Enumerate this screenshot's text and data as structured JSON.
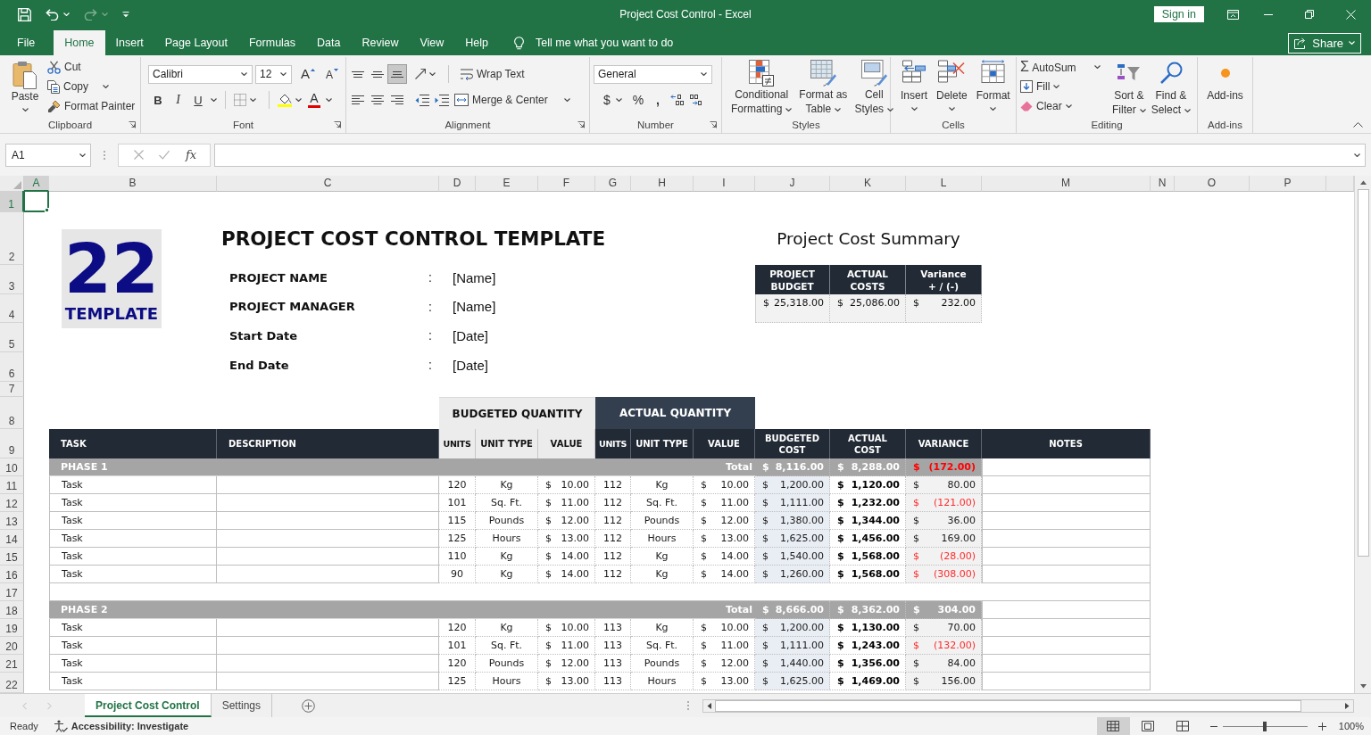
{
  "window": {
    "title": "Project Cost Control - Excel",
    "sign_in": "Sign in"
  },
  "quick_access": [
    {
      "kind": "save",
      "disabled": false
    },
    {
      "kind": "undo",
      "disabled": false
    },
    {
      "kind": "redo",
      "disabled": true
    },
    {
      "kind": "customize",
      "disabled": false
    }
  ],
  "menu": {
    "tabs": [
      {
        "label": "File",
        "selected": false
      },
      {
        "label": "Home",
        "selected": true
      },
      {
        "label": "Insert",
        "selected": false
      },
      {
        "label": "Page Layout",
        "selected": false
      },
      {
        "label": "Formulas",
        "selected": false
      },
      {
        "label": "Data",
        "selected": false
      },
      {
        "label": "Review",
        "selected": false
      },
      {
        "label": "View",
        "selected": false
      },
      {
        "label": "Help",
        "selected": false
      }
    ],
    "tell_me": "Tell me what you want to do",
    "share": "Share"
  },
  "ribbon": [
    {
      "kind": "clipboard",
      "label": "Clipboard",
      "launcher": true,
      "paste": "Paste",
      "cut": "Cut",
      "copy": "Copy",
      "format_painter": "Format Painter"
    },
    {
      "kind": "font",
      "label": "Font",
      "launcher": true,
      "font_name": "Calibri",
      "font_size": "12",
      "grow": "A",
      "shrink": "A",
      "bold": "B",
      "italic": "I",
      "underline": "U",
      "font_color": "A"
    },
    {
      "kind": "alignment",
      "label": "Alignment",
      "launcher": true,
      "vertical_align": [
        {
          "kind": "top",
          "selected": false
        },
        {
          "kind": "middle",
          "selected": false
        },
        {
          "kind": "bottom",
          "selected": true
        }
      ],
      "wrap_text": "Wrap Text",
      "merge": "Merge & Center"
    },
    {
      "kind": "number",
      "label": "Number",
      "launcher": true,
      "format": "General",
      "currency": "$",
      "percent": "%",
      "comma": ","
    },
    {
      "kind": "styles",
      "label": "Styles",
      "launcher": false,
      "buttons": [
        {
          "kind": "conditional",
          "label": "Conditional\nFormatting"
        },
        {
          "kind": "table",
          "label": "Format as\nTable"
        },
        {
          "kind": "cell",
          "label": "Cell\nStyles"
        }
      ]
    },
    {
      "kind": "cells",
      "label": "Cells",
      "launcher": false,
      "buttons": [
        {
          "kind": "insert",
          "label": "Insert"
        },
        {
          "kind": "delete",
          "label": "Delete"
        },
        {
          "kind": "format",
          "label": "Format"
        }
      ]
    },
    {
      "kind": "editing",
      "label": "Editing",
      "launcher": false,
      "sum_symbol": "Σ",
      "autosum": "AutoSum",
      "fill": "Fill",
      "clear": "Clear",
      "sort": "Sort &\nFilter",
      "find": "Find &\nSelect"
    },
    {
      "kind": "addins",
      "label": "Add-ins",
      "launcher": false,
      "button": "Add-ins"
    }
  ],
  "formula_bar": {
    "name_box": "A1",
    "function": "fx"
  },
  "sheet": {
    "columns": [
      {
        "label": "A",
        "selected": true
      },
      {
        "label": "B",
        "selected": false
      },
      {
        "label": "C",
        "selected": false
      },
      {
        "label": "D",
        "selected": false
      },
      {
        "label": "E",
        "selected": false
      },
      {
        "label": "F",
        "selected": false
      },
      {
        "label": "G",
        "selected": false
      },
      {
        "label": "H",
        "selected": false
      },
      {
        "label": "I",
        "selected": false
      },
      {
        "label": "J",
        "selected": false
      },
      {
        "label": "K",
        "selected": false
      },
      {
        "label": "L",
        "selected": false
      },
      {
        "label": "M",
        "selected": false
      },
      {
        "label": "N",
        "selected": false
      },
      {
        "label": "O",
        "selected": false
      },
      {
        "label": "P",
        "selected": false
      }
    ],
    "rows": [
      {
        "label": "1",
        "selected": true
      },
      {
        "label": "2",
        "selected": false
      },
      {
        "label": "3",
        "selected": false
      },
      {
        "label": "4",
        "selected": false
      },
      {
        "label": "5",
        "selected": false
      },
      {
        "label": "6",
        "selected": false
      },
      {
        "label": "7",
        "selected": false
      },
      {
        "label": "8",
        "selected": false
      },
      {
        "label": "9",
        "selected": false
      },
      {
        "label": "10",
        "selected": false
      },
      {
        "label": "11",
        "selected": false
      },
      {
        "label": "12",
        "selected": false
      },
      {
        "label": "13",
        "selected": false
      },
      {
        "label": "14",
        "selected": false
      },
      {
        "label": "15",
        "selected": false
      },
      {
        "label": "16",
        "selected": false
      },
      {
        "label": "17",
        "selected": false
      },
      {
        "label": "18",
        "selected": false
      },
      {
        "label": "19",
        "selected": false
      },
      {
        "label": "20",
        "selected": false
      },
      {
        "label": "21",
        "selected": false
      },
      {
        "label": "22",
        "selected": false
      }
    ]
  },
  "logo": {
    "number": "22",
    "word": "TEMPLATE"
  },
  "title": "PROJECT COST CONTROL TEMPLATE",
  "details": [
    {
      "label": "PROJECT NAME",
      "separator": ":",
      "value": "[Name]"
    },
    {
      "label": "PROJECT MANAGER",
      "separator": ":",
      "value": "[Name]"
    },
    {
      "label": "Start Date",
      "separator": ":",
      "value": "[Date]"
    },
    {
      "label": "End Date",
      "separator": ":",
      "value": "[Date]"
    }
  ],
  "summary": {
    "title": "Project Cost Summary",
    "columns": [
      "PROJECT\nBUDGET",
      "ACTUAL\nCOSTS",
      "Variance\n+ / (-)"
    ],
    "values": [
      {
        "currency": "$",
        "amount": "25,318.00"
      },
      {
        "currency": "$",
        "amount": "25,086.00"
      },
      {
        "currency": "$",
        "amount": "232.00"
      }
    ]
  },
  "table": {
    "header": {
      "task": "TASK",
      "description": "DESCRIPTION",
      "budgeted_quantity": {
        "label": "BUDGETED QUANTITY",
        "units": "UNITS",
        "unit_type": "UNIT TYPE",
        "value": "VALUE"
      },
      "actual_quantity": {
        "label": "ACTUAL QUANTITY",
        "units": "UNITS",
        "unit_type": "UNIT TYPE",
        "value": "VALUE"
      },
      "budgeted_cost": "BUDGETED\nCOST",
      "actual_cost": "ACTUAL\nCOST",
      "variance": "VARIANCE",
      "notes": "NOTES"
    },
    "phases": [
      {
        "label": "PHASE 1",
        "total_label": "Total",
        "budgeted_cost": {
          "currency": "$",
          "amount": "8,116.00"
        },
        "actual_cost": {
          "currency": "$",
          "amount": "8,288.00"
        },
        "variance": {
          "currency": "$",
          "amount": "(172.00)",
          "negative": true
        },
        "tasks": [
          {
            "task": "Task",
            "budgeted": {
              "units": "120",
              "unit_type": "Kg",
              "value": {
                "currency": "$",
                "amount": "10.00"
              }
            },
            "actual": {
              "units": "112",
              "unit_type": "Kg",
              "value": {
                "currency": "$",
                "amount": "10.00"
              }
            },
            "budgeted_cost": {
              "currency": "$",
              "amount": "1,200.00"
            },
            "actual_cost": {
              "currency": "$",
              "amount": "1,120.00"
            },
            "variance": {
              "currency": "$",
              "amount": "80.00",
              "negative": false
            }
          },
          {
            "task": "Task",
            "budgeted": {
              "units": "101",
              "unit_type": "Sq. Ft.",
              "value": {
                "currency": "$",
                "amount": "11.00"
              }
            },
            "actual": {
              "units": "112",
              "unit_type": "Sq. Ft.",
              "value": {
                "currency": "$",
                "amount": "11.00"
              }
            },
            "budgeted_cost": {
              "currency": "$",
              "amount": "1,111.00"
            },
            "actual_cost": {
              "currency": "$",
              "amount": "1,232.00"
            },
            "variance": {
              "currency": "$",
              "amount": "(121.00)",
              "negative": true
            }
          },
          {
            "task": "Task",
            "budgeted": {
              "units": "115",
              "unit_type": "Pounds",
              "value": {
                "currency": "$",
                "amount": "12.00"
              }
            },
            "actual": {
              "units": "112",
              "unit_type": "Pounds",
              "value": {
                "currency": "$",
                "amount": "12.00"
              }
            },
            "budgeted_cost": {
              "currency": "$",
              "amount": "1,380.00"
            },
            "actual_cost": {
              "currency": "$",
              "amount": "1,344.00"
            },
            "variance": {
              "currency": "$",
              "amount": "36.00",
              "negative": false
            }
          },
          {
            "task": "Task",
            "budgeted": {
              "units": "125",
              "unit_type": "Hours",
              "value": {
                "currency": "$",
                "amount": "13.00"
              }
            },
            "actual": {
              "units": "112",
              "unit_type": "Hours",
              "value": {
                "currency": "$",
                "amount": "13.00"
              }
            },
            "budgeted_cost": {
              "currency": "$",
              "amount": "1,625.00"
            },
            "actual_cost": {
              "currency": "$",
              "amount": "1,456.00"
            },
            "variance": {
              "currency": "$",
              "amount": "169.00",
              "negative": false
            }
          },
          {
            "task": "Task",
            "budgeted": {
              "units": "110",
              "unit_type": "Kg",
              "value": {
                "currency": "$",
                "amount": "14.00"
              }
            },
            "actual": {
              "units": "112",
              "unit_type": "Kg",
              "value": {
                "currency": "$",
                "amount": "14.00"
              }
            },
            "budgeted_cost": {
              "currency": "$",
              "amount": "1,540.00"
            },
            "actual_cost": {
              "currency": "$",
              "amount": "1,568.00"
            },
            "variance": {
              "currency": "$",
              "amount": "(28.00)",
              "negative": true
            }
          },
          {
            "task": "Task",
            "budgeted": {
              "units": "90",
              "unit_type": "Kg",
              "value": {
                "currency": "$",
                "amount": "14.00"
              }
            },
            "actual": {
              "units": "112",
              "unit_type": "Kg",
              "value": {
                "currency": "$",
                "amount": "14.00"
              }
            },
            "budgeted_cost": {
              "currency": "$",
              "amount": "1,260.00"
            },
            "actual_cost": {
              "currency": "$",
              "amount": "1,568.00"
            },
            "variance": {
              "currency": "$",
              "amount": "(308.00)",
              "negative": true
            }
          }
        ]
      },
      {
        "label": "PHASE 2",
        "total_label": "Total",
        "budgeted_cost": {
          "currency": "$",
          "amount": "8,666.00"
        },
        "actual_cost": {
          "currency": "$",
          "amount": "8,362.00"
        },
        "variance": {
          "currency": "$",
          "amount": "304.00",
          "negative": false
        },
        "tasks": [
          {
            "task": "Task",
            "budgeted": {
              "units": "120",
              "unit_type": "Kg",
              "value": {
                "currency": "$",
                "amount": "10.00"
              }
            },
            "actual": {
              "units": "113",
              "unit_type": "Kg",
              "value": {
                "currency": "$",
                "amount": "10.00"
              }
            },
            "budgeted_cost": {
              "currency": "$",
              "amount": "1,200.00"
            },
            "actual_cost": {
              "currency": "$",
              "amount": "1,130.00"
            },
            "variance": {
              "currency": "$",
              "amount": "70.00",
              "negative": false
            }
          },
          {
            "task": "Task",
            "budgeted": {
              "units": "101",
              "unit_type": "Sq. Ft.",
              "value": {
                "currency": "$",
                "amount": "11.00"
              }
            },
            "actual": {
              "units": "113",
              "unit_type": "Sq. Ft.",
              "value": {
                "currency": "$",
                "amount": "11.00"
              }
            },
            "budgeted_cost": {
              "currency": "$",
              "amount": "1,111.00"
            },
            "actual_cost": {
              "currency": "$",
              "amount": "1,243.00"
            },
            "variance": {
              "currency": "$",
              "amount": "(132.00)",
              "negative": true
            }
          },
          {
            "task": "Task",
            "budgeted": {
              "units": "120",
              "unit_type": "Pounds",
              "value": {
                "currency": "$",
                "amount": "12.00"
              }
            },
            "actual": {
              "units": "113",
              "unit_type": "Pounds",
              "value": {
                "currency": "$",
                "amount": "12.00"
              }
            },
            "budgeted_cost": {
              "currency": "$",
              "amount": "1,440.00"
            },
            "actual_cost": {
              "currency": "$",
              "amount": "1,356.00"
            },
            "variance": {
              "currency": "$",
              "amount": "84.00",
              "negative": false
            }
          },
          {
            "task": "Task",
            "budgeted": {
              "units": "125",
              "unit_type": "Hours",
              "value": {
                "currency": "$",
                "amount": "13.00"
              }
            },
            "actual": {
              "units": "113",
              "unit_type": "Hours",
              "value": {
                "currency": "$",
                "amount": "13.00"
              }
            },
            "budgeted_cost": {
              "currency": "$",
              "amount": "1,625.00"
            },
            "actual_cost": {
              "currency": "$",
              "amount": "1,469.00"
            },
            "variance": {
              "currency": "$",
              "amount": "156.00",
              "negative": false
            }
          }
        ]
      }
    ]
  },
  "sheet_tabs": [
    {
      "label": "Project Cost Control",
      "selected": true
    },
    {
      "label": "Settings",
      "selected": false
    }
  ],
  "status_bar": {
    "status": "Ready",
    "accessibility": "Accessibility: Investigate",
    "views": [
      {
        "kind": "normal",
        "selected": true
      },
      {
        "kind": "page_layout",
        "selected": false
      },
      {
        "kind": "page_break",
        "selected": false
      }
    ],
    "zoom": {
      "level": 0.5,
      "reading": "100%"
    }
  }
}
